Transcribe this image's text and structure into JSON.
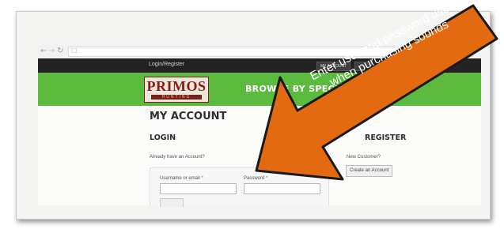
{
  "browser": {
    "back_icon": "back-arrow-icon",
    "forward_icon": "forward-arrow-icon",
    "reload_icon": "reload-icon",
    "page_icon": "page-icon"
  },
  "topbar": {
    "login_register": "Login/Register",
    "my_account_button": "MY ACCOUNT",
    "second_button": ""
  },
  "navbar": {
    "logo_name": "PRIMOS",
    "logo_sub": "HUNTING",
    "browse_species": "BROWSE BY SPECIES"
  },
  "page": {
    "title": "MY ACCOUNT",
    "login": {
      "heading": "LOGIN",
      "prompt": "Already have an Account?",
      "username_label": "Username or email",
      "password_label": "Password",
      "required_mark": "*"
    },
    "register": {
      "heading": "REGISTER",
      "prompt": "New Customer?",
      "button": "Create an Account"
    }
  },
  "annotation": {
    "text": "Enter user and password used when purchasing sounds",
    "color": "#e46a12"
  },
  "colors": {
    "green_nav": "#5cbb3e",
    "top_bar": "#222222",
    "logo_red": "#8a1818"
  }
}
